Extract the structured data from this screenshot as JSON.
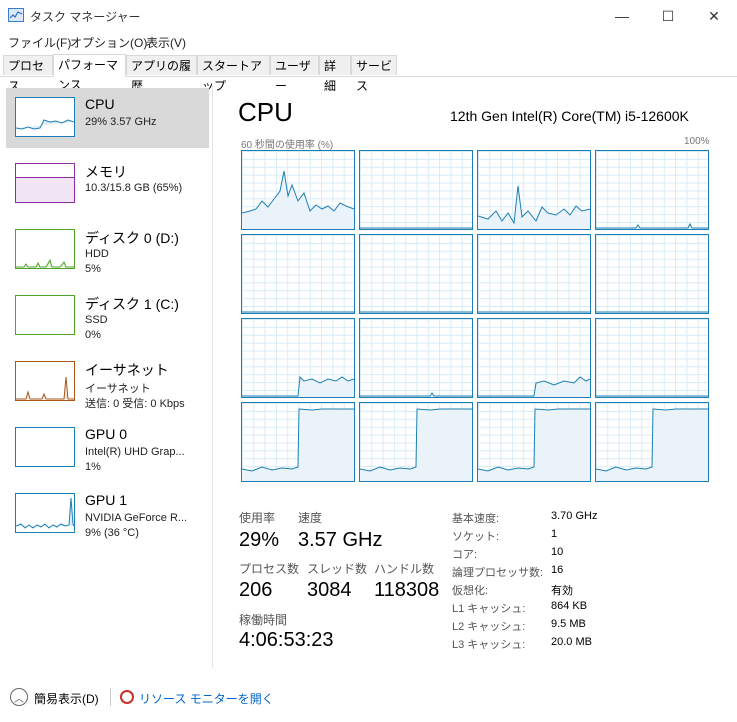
{
  "window": {
    "title": "タスク マネージャー",
    "controls": {
      "minimize": "—",
      "maximize": "☐",
      "close": "✕"
    }
  },
  "menu": [
    "ファイル(F)",
    "オプション(O)",
    "表示(V)"
  ],
  "tabs": [
    "プロセス",
    "パフォーマンス",
    "アプリの履歴",
    "スタートアップ",
    "ユーザー",
    "詳細",
    "サービス"
  ],
  "active_tab": "パフォーマンス",
  "sidebar": [
    {
      "title": "CPU",
      "sub1": "29%  3.57 GHz",
      "sub2": "",
      "color": "#1b7fb5",
      "selected": true
    },
    {
      "title": "メモリ",
      "sub1": "10.3/15.8 GB (65%)",
      "sub2": "",
      "color": "#8b2fa0",
      "selected": false
    },
    {
      "title": "ディスク 0 (D:)",
      "sub1": "HDD",
      "sub2": "5%",
      "color": "#4da32b",
      "selected": false
    },
    {
      "title": "ディスク 1 (C:)",
      "sub1": "SSD",
      "sub2": "0%",
      "color": "#4da32b",
      "selected": false
    },
    {
      "title": "イーサネット",
      "sub1": "イーサネット",
      "sub2": "送信: 0  受信: 0 Kbps",
      "color": "#a7571a",
      "selected": false
    },
    {
      "title": "GPU 0",
      "sub1": "Intel(R) UHD Grap...",
      "sub2": "1%",
      "color": "#1b7fb5",
      "selected": false
    },
    {
      "title": "GPU 1",
      "sub1": "NVIDIA GeForce R...",
      "sub2": "9% (36 °C)",
      "color": "#1b7fb5",
      "selected": false
    }
  ],
  "main": {
    "title": "CPU",
    "model": "12th Gen Intel(R) Core(TM) i5-12600K",
    "graph_label_left": "60 秒間の使用率 (%)",
    "graph_label_right": "100%",
    "accent": "#1b7fb5",
    "stats": {
      "usage_label": "使用率",
      "usage_value": "29%",
      "speed_label": "速度",
      "speed_value": "3.57 GHz",
      "processes_label": "プロセス数",
      "processes_value": "206",
      "threads_label": "スレッド数",
      "threads_value": "3084",
      "handles_label": "ハンドル数",
      "handles_value": "118308",
      "uptime_label": "稼働時間",
      "uptime_value": "4:06:53:23"
    },
    "details": [
      {
        "key": "基本速度:",
        "value": "3.70 GHz"
      },
      {
        "key": "ソケット:",
        "value": "1"
      },
      {
        "key": "コア:",
        "value": "10"
      },
      {
        "key": "論理プロセッサ数:",
        "value": "16"
      },
      {
        "key": "仮想化:",
        "value": "有効"
      },
      {
        "key": "L1 キャッシュ:",
        "value": "864 KB"
      },
      {
        "key": "L2 キャッシュ:",
        "value": "9.5 MB"
      },
      {
        "key": "L3 キャッシュ:",
        "value": "20.0 MB"
      }
    ]
  },
  "footer": {
    "fewer_details": "簡易表示(D)",
    "resource_monitor": "リソース モニターを開く"
  }
}
